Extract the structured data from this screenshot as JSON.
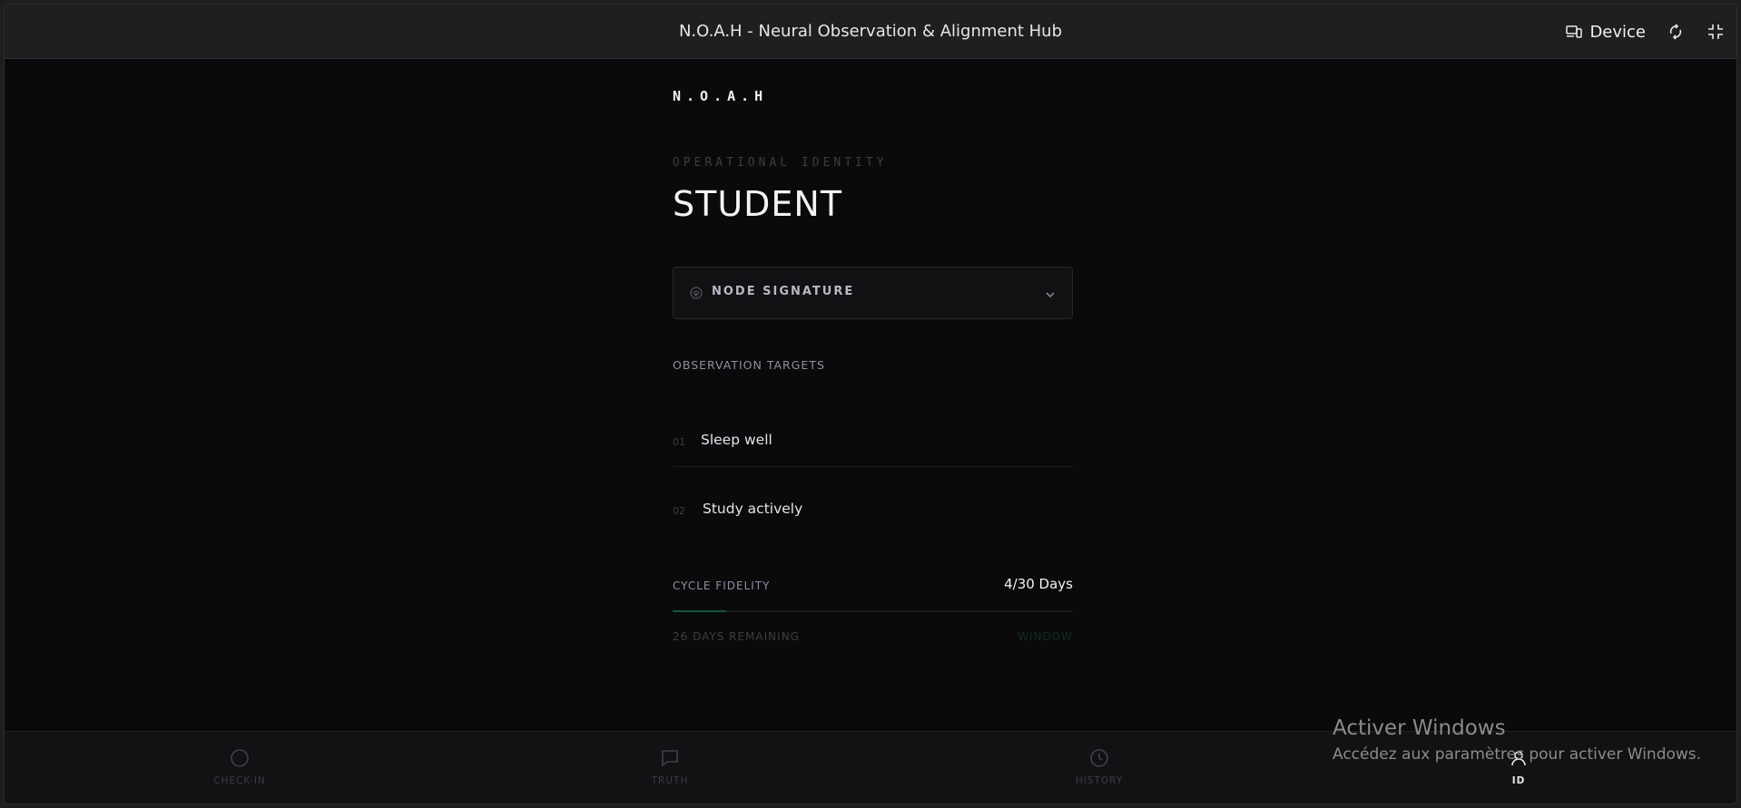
{
  "titlebar": {
    "title": "N.O.A.H - Neural Observation & Alignment Hub",
    "device_label": "Device",
    "icons": [
      "device-icon",
      "rotate-icon",
      "fullscreen-icon"
    ]
  },
  "brand": "N.O.A.H",
  "identity": {
    "label": "OPERATIONAL IDENTITY",
    "role": "STUDENT"
  },
  "node_signature": {
    "label": "NODE SIGNATURE",
    "icon": "fingerprint-icon"
  },
  "targets": {
    "label": "OBSERVATION TARGETS",
    "items": [
      {
        "num": "01",
        "text": "Sleep well"
      },
      {
        "num": "02",
        "text": "Study actively"
      }
    ]
  },
  "cycle": {
    "label": "CYCLE FIDELITY",
    "value": "4/30 Days",
    "progress": 0.133,
    "remaining": "26 DAYS REMAINING",
    "window_label": "WINDOW"
  },
  "nav": {
    "items": [
      {
        "label": "CHECK-IN",
        "icon": "circle-icon",
        "active": false
      },
      {
        "label": "TRUTH",
        "icon": "message-icon",
        "active": false
      },
      {
        "label": "HISTORY",
        "icon": "clock-icon",
        "active": false
      },
      {
        "label": "ID",
        "icon": "id-icon",
        "active": true
      }
    ]
  },
  "watermark": {
    "title": "Activer Windows",
    "subtitle": "Accédez aux paramètres pour activer Windows."
  },
  "colors": {
    "background": "#0a0a0b",
    "accent_green": "#0f5a3c",
    "muted_text": "#8c90a0"
  }
}
